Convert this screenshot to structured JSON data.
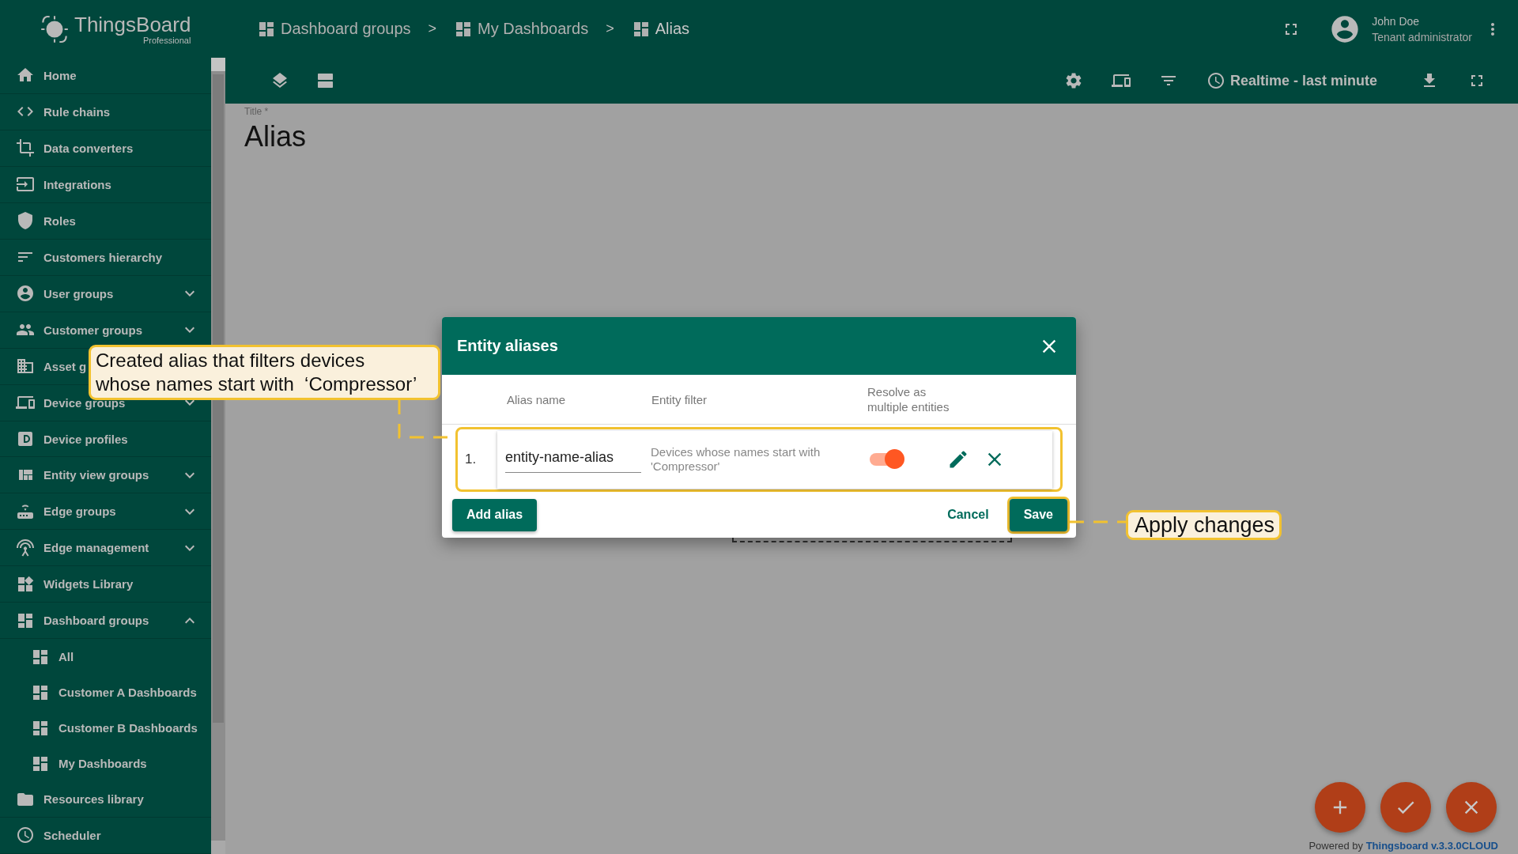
{
  "app": {
    "logo_text": "ThingsBoard",
    "logo_subtitle": "Professional"
  },
  "sidebar": {
    "items": [
      {
        "label": "Home",
        "kind": "link"
      },
      {
        "label": "Rule chains",
        "kind": "link"
      },
      {
        "label": "Data converters",
        "kind": "link"
      },
      {
        "label": "Integrations",
        "kind": "link"
      },
      {
        "label": "Roles",
        "kind": "link"
      },
      {
        "label": "Customers hierarchy",
        "kind": "link"
      },
      {
        "label": "User groups",
        "kind": "group",
        "expanded": false
      },
      {
        "label": "Customer groups",
        "kind": "group",
        "expanded": false
      },
      {
        "label": "Asset g",
        "kind": "link"
      },
      {
        "label": "Device groups",
        "kind": "group",
        "expanded": false
      },
      {
        "label": "Device profiles",
        "kind": "link"
      },
      {
        "label": "Entity view groups",
        "kind": "group",
        "expanded": false
      },
      {
        "label": "Edge groups",
        "kind": "group",
        "expanded": false
      },
      {
        "label": "Edge management",
        "kind": "group",
        "expanded": false
      },
      {
        "label": "Widgets Library",
        "kind": "link"
      },
      {
        "label": "Dashboard groups",
        "kind": "group",
        "expanded": true,
        "children": [
          {
            "label": "All"
          },
          {
            "label": "Customer A Dashboards"
          },
          {
            "label": "Customer B Dashboards"
          },
          {
            "label": "My Dashboards"
          }
        ]
      },
      {
        "label": "Resources library",
        "kind": "link"
      },
      {
        "label": "Scheduler",
        "kind": "link"
      }
    ]
  },
  "breadcrumbs": [
    {
      "label": "Dashboard groups",
      "separator": ">"
    },
    {
      "label": "My Dashboards",
      "separator": ">"
    },
    {
      "label": "Alias"
    }
  ],
  "user": {
    "name": "John Doe",
    "role": "Tenant administrator"
  },
  "toolbar": {
    "timewindow": "Realtime - last minute"
  },
  "dashboard": {
    "title_label": "Title *",
    "title": "Alias"
  },
  "dialog": {
    "title": "Entity aliases",
    "columns": [
      "Alias name",
      "Entity filter",
      "Resolve as multiple entities"
    ],
    "rows": [
      {
        "index": "1.",
        "alias_name": "entity-name-alias",
        "entity_filter": "Devices whose names start with 'Compressor'",
        "resolve_multiple": true,
        "highlighted": true
      }
    ],
    "buttons": [
      {
        "label": "Add alias",
        "kind": "raised",
        "highlighted": false
      },
      {
        "label": "Cancel",
        "kind": "text",
        "highlighted": false
      },
      {
        "label": "Save",
        "kind": "raised",
        "highlighted": true
      }
    ]
  },
  "callouts": [
    {
      "lines": [
        "Created alias that filters devices",
        "whose names start with  ‘Compressor’"
      ]
    },
    {
      "lines": [
        "Apply changes"
      ]
    }
  ],
  "fab_buttons": [
    {
      "kind": "add"
    },
    {
      "kind": "confirm"
    },
    {
      "kind": "close"
    }
  ],
  "footer": {
    "text": "Powered by",
    "link": "Thingsboard v.3.3.0CLOUD"
  }
}
